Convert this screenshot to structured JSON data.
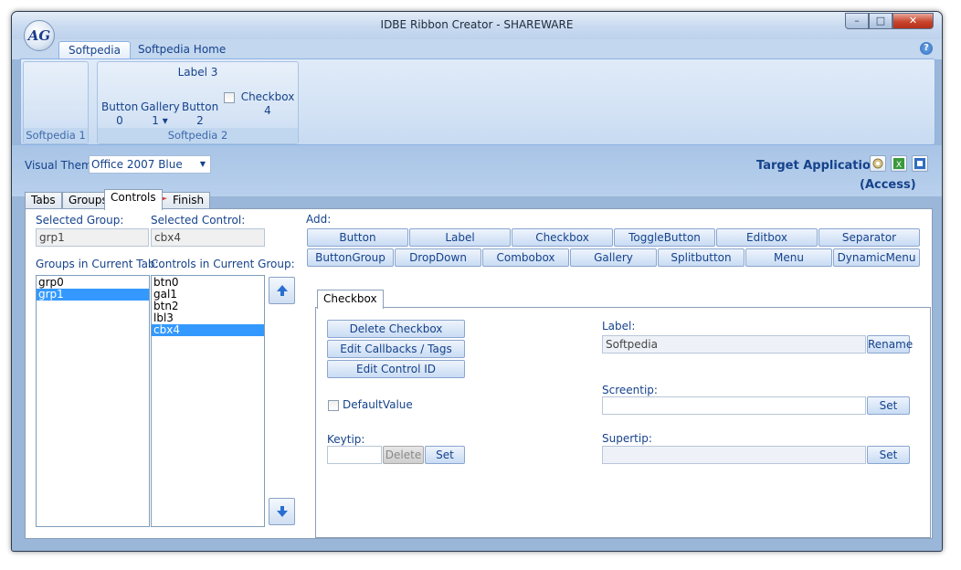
{
  "window": {
    "title": "IDBE Ribbon Creator - SHAREWARE",
    "logo_text": "AG",
    "min": "–",
    "max": "□",
    "close": "✕"
  },
  "ribbon": {
    "tabs": [
      {
        "label": "Softpedia"
      },
      {
        "label": "Softpedia Home"
      }
    ],
    "help": "?",
    "groups": [
      {
        "label": "Softpedia 1"
      },
      {
        "label": "Softpedia 2",
        "top_label": "Label 3",
        "buttons": [
          {
            "label": "Button",
            "sub": "0"
          },
          {
            "label": "Gallery",
            "sub": "1 ▾"
          },
          {
            "label": "Button",
            "sub": "2"
          }
        ],
        "checkbox": "Checkbox 4"
      }
    ]
  },
  "theme": {
    "label": "Visual Theme:",
    "value": "Office 2007 Blue"
  },
  "target": {
    "label": "Target Application:",
    "app": "(Access)",
    "icons": [
      "gear-icon",
      "excel-icon",
      "outlook-icon"
    ]
  },
  "tabs": [
    {
      "label": "Tabs"
    },
    {
      "label": "Groups"
    },
    {
      "label": "Controls"
    },
    {
      "label": "Finish"
    }
  ],
  "controls_panel": {
    "selected_group_label": "Selected Group:",
    "selected_group": "grp1",
    "selected_control_label": "Selected Control:",
    "selected_control": "cbx4",
    "groups_list_label": "Groups in Current Tab:",
    "groups": [
      "grp0",
      "grp1"
    ],
    "controls_list_label": "Controls in Current Group:",
    "controls": [
      "btn0",
      "gal1",
      "btn2",
      "lbl3",
      "cbx4"
    ],
    "add_label": "Add:",
    "add_row1": [
      "Button",
      "Label",
      "Checkbox",
      "ToggleButton",
      "Editbox",
      "Separator"
    ],
    "add_row2": [
      "ButtonGroup",
      "DropDown",
      "Combobox",
      "Gallery",
      "Splitbutton",
      "Menu",
      "DynamicMenu"
    ]
  },
  "editor": {
    "tab": "Checkbox",
    "delete_btn": "Delete Checkbox",
    "callbacks_btn": "Edit Callbacks / Tags",
    "control_id_btn": "Edit Control ID",
    "default_value": "DefaultValue",
    "keytip_label": "Keytip:",
    "keytip_delete": "Delete",
    "keytip_set": "Set",
    "label_label": "Label:",
    "label_value": "Softpedia",
    "rename": "Rename",
    "screentip_label": "Screentip:",
    "screentip_set": "Set",
    "supertip_label": "Supertip:",
    "supertip_set": "Set"
  }
}
